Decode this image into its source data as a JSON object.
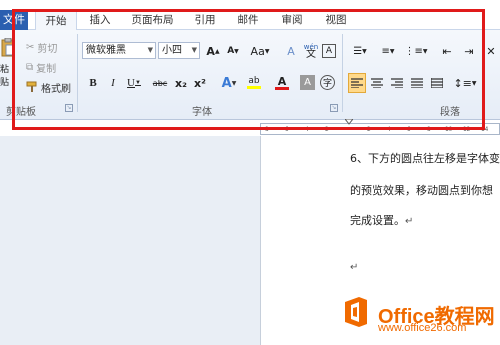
{
  "tabs": {
    "file": "文件",
    "items": [
      "开始",
      "插入",
      "页面布局",
      "引用",
      "邮件",
      "审阅",
      "视图"
    ],
    "active": "开始"
  },
  "clipboard": {
    "paste_label": "粘贴",
    "cut_label": "剪切",
    "copy_label": "复制",
    "format_painter_label": "格式刷",
    "group_label": "剪贴板"
  },
  "font": {
    "font_name": "微软雅黑",
    "font_size": "小四",
    "grow_label": "A",
    "shrink_label": "A",
    "change_case_label": "Aa",
    "clear_label": "A",
    "phonetic_label": "wén",
    "border_label": "A",
    "bold_label": "B",
    "italic_label": "I",
    "underline_label": "U",
    "strike_label": "abc",
    "subscript_label": "x₂",
    "superscript_label": "x²",
    "effects_label": "A",
    "highlight_label": "ab",
    "font_color_label": "A",
    "shading_label": "A",
    "enclose_label": "字",
    "group_label": "字体"
  },
  "paragraph": {
    "group_label": "段落"
  },
  "ruler": {
    "ticks": [
      "8",
      "6",
      "4",
      "2",
      "",
      "2",
      "4",
      "6",
      "8",
      "10",
      "12",
      "14",
      "16"
    ]
  },
  "document": {
    "line1": "6、下方的圆点往左移是字体变",
    "line2": "的预览效果，移动圆点到你想",
    "line3": "完成设置。"
  },
  "watermark": {
    "title": "Office教程网",
    "url": "www.office26.com"
  },
  "colors": {
    "highlight_frame": "#e01a1a",
    "file_tab": "#2a5fb0",
    "watermark": "#f06a00",
    "align_active": "#ffd98a"
  }
}
